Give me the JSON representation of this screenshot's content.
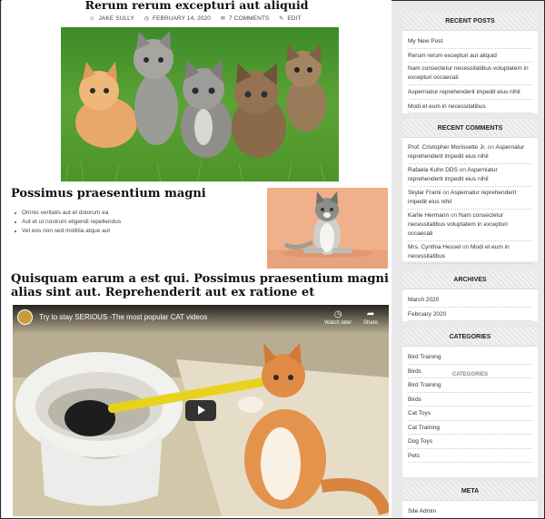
{
  "post": {
    "title": "Rerum rerum excepturi aut aliquid",
    "meta": {
      "author": "JAKE SULLY",
      "date": "FEBRUARY 14, 2020",
      "comments": "7 COMMENTS",
      "edit": "EDIT"
    }
  },
  "section2": {
    "title": "Possimus praesentium magni",
    "items": [
      "Omnis veritatis aut et dolorum ea",
      "Aut et ut nostrum eligendi repellendus",
      "Vel eos non sed mollitia atque aut"
    ]
  },
  "section3": {
    "title": "Quisquam earum a est qui. Possimus praesentium magni alias sint aut. Reprehenderit aut ex ratione et"
  },
  "video": {
    "title": "Try to stay SERIOUS -The most popular CAT videos",
    "watch_later": "Watch later",
    "share": "Share"
  },
  "sidebar": {
    "recent_posts": {
      "title": "RECENT POSTS",
      "items": [
        "My New Post",
        "Rerum rerum excepturi aut aliquid",
        "Nam consectetur necessitatibus voluptatem in excepturi occaecati",
        "Asperniatur reprehenderit impedit eius nihil",
        "Modi et eum in necessitatibus"
      ]
    },
    "recent_comments": {
      "title": "RECENT COMMENTS",
      "on": "on",
      "items": [
        {
          "author": "Prof. Cristopher Morissette Jr.",
          "post": "Aspernatur reprehenderit impedit eius nihil"
        },
        {
          "author": "Rafaela Kuhn DDS",
          "post": "Asperniatur reprehenderit impedit eius nihil"
        },
        {
          "author": "Skylar Frami",
          "post": "Aspernatur reprehenderit impedit eius nihil"
        },
        {
          "author": "Karlie Hermann",
          "post": "Nam consectetur necessitatibus voluptatem in excepturi occaecati"
        },
        {
          "author": "Mrs. Cynthia Hessel",
          "post": "Modi et eum in necessitatibus"
        }
      ]
    },
    "archives": {
      "title": "ARCHIVES",
      "items": [
        "March 2020",
        "February 2020"
      ]
    },
    "categories": {
      "title": "CATEGORIES",
      "overlap_title": "CATEGORIES",
      "items": [
        "Bird Training",
        "Birds",
        "Bird Training",
        "Birds",
        "Cat Toys",
        "Cat Training",
        "Dog Toys",
        "Pets"
      ]
    },
    "meta": {
      "title": "META",
      "items": [
        "Site Admin"
      ]
    }
  },
  "colors": {
    "page_bg": "#e9e9e9",
    "widget_title_bg": "#ececec",
    "text_dark": "#111111",
    "video_bar": "#212121"
  },
  "icons": [
    "user-icon",
    "clock-icon",
    "comments-icon",
    "edit-icon",
    "watch-later-icon",
    "share-icon",
    "play-icon"
  ]
}
